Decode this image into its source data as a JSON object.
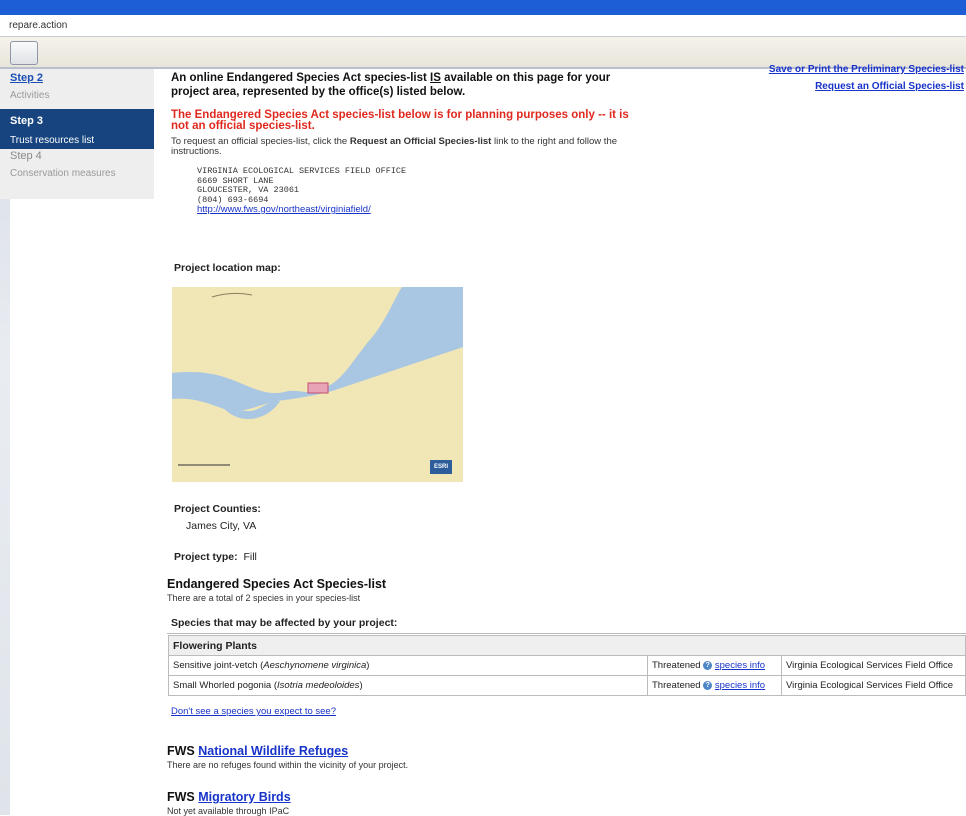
{
  "browser": {
    "url_fragment": "repare.action"
  },
  "sidebar": {
    "steps": [
      {
        "title": "Step 2",
        "subtitle": "Activities"
      },
      {
        "title": "Step 3",
        "subtitle": "Trust resources list"
      },
      {
        "title": "Step 4",
        "subtitle": "Conservation measures"
      }
    ]
  },
  "header": {
    "line1_before": "An online Endangered Species Act species-list ",
    "line1_emph": "IS",
    "line1_after": " available on this page for your",
    "line2": "project area, represented by the office(s) listed below.",
    "warning": "The Endangered Species Act species-list below is for planning purposes only -- it is not an official species-list.",
    "instruction_before": "To request an official species-list, click the ",
    "instruction_link_text": "Request an Official Species-list",
    "instruction_after": " link to the right and follow the instructions."
  },
  "right_links": {
    "save": "Save or Print the Preliminary Species-list",
    "request": "Request an Official Species-list"
  },
  "office": {
    "name": "VIRGINIA ECOLOGICAL SERVICES FIELD OFFICE",
    "street": "6669 SHORT LANE",
    "city": "GLOUCESTER, VA 23061",
    "phone": "(804) 693-6694",
    "url": "http://www.fws.gov/northeast/virginiafield/"
  },
  "map_section": {
    "label": "Project location map:",
    "logo": "ESRI"
  },
  "project": {
    "counties_label": "Project Counties:",
    "counties_value": "James City, VA",
    "type_label": "Project type:",
    "type_value": "Fill"
  },
  "esa": {
    "heading": "Endangered Species Act Species-list",
    "subtext": "There are a total of 2 species in your species-list",
    "affected_label": "Species that may be affected by your project:",
    "category": "Flowering Plants",
    "rows": [
      {
        "common": "Sensitive joint-vetch",
        "sci": "Aeschynomene virginica",
        "status": "Threatened",
        "info": "species info",
        "office": "Virginia Ecological Services Field Office"
      },
      {
        "common": "Small Whorled pogonia",
        "sci": "Isotria medeoloides",
        "status": "Threatened",
        "info": "species info",
        "office": "Virginia Ecological Services Field Office"
      }
    ],
    "missing_link": "Don't see a species you expect to see?"
  },
  "refuges": {
    "prefix": "FWS",
    "link": "National Wildlife Refuges",
    "text": "There are no refuges found within the vicinity of your project."
  },
  "birds": {
    "prefix": "FWS",
    "link": "Migratory Birds",
    "text": "Not yet available through IPaC"
  }
}
